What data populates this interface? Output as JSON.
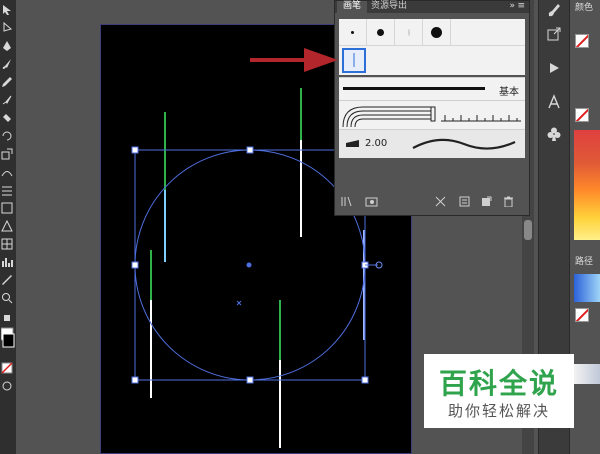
{
  "brush_panel": {
    "tabs": [
      {
        "label": "画笔"
      },
      {
        "label": "资源导出"
      }
    ],
    "menu_glyph": "≡",
    "collapse_glyph": "»",
    "rows": {
      "basic_label": "基本",
      "brush_size": "2.00"
    }
  },
  "watermark": {
    "title": "百科全说",
    "subtitle": "助你轻松解决"
  },
  "color_panel": {
    "color_tab": "颜色",
    "path_tab": "路径"
  },
  "colors": {
    "selection_blue": "#4f6fe0",
    "arrow_red": "#b3262b",
    "watermark_green": "#2fa44c",
    "artboard_black": "#000000"
  },
  "icons": [
    "selection-tool-icon",
    "pen-tool-icon",
    "brush-tool-icon",
    "eraser-tool-icon",
    "brush-library-icon",
    "new-brush-icon",
    "delete-brush-icon",
    "remove-stroke-icon",
    "options-icon",
    "club-symbol-icon",
    "type-icon",
    "play-icon",
    "export-icon"
  ]
}
